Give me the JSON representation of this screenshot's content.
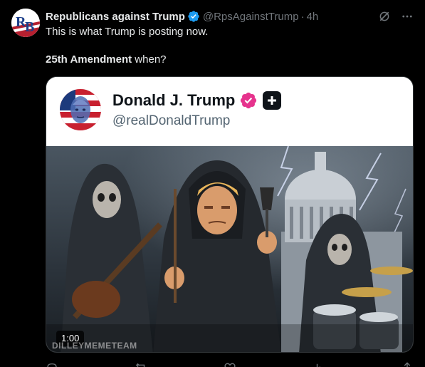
{
  "post": {
    "author_name": "Republicans against Trump",
    "author_avatar_text": "RB",
    "handle": "@RpsAgainstTrump",
    "separator": "·",
    "time": "4h",
    "text_line1": "This is what Trump is posting now.",
    "text_line2_bold": "25th Amendment",
    "text_line2_rest": " when?"
  },
  "embedded": {
    "name": "Donald J. Trump",
    "handle": "@realDonaldTrump",
    "video_time": "1:00",
    "watermark": "DILLEYMEMETEAM"
  },
  "colors": {
    "background": "#000000",
    "verified_blue": "#1d9bf0",
    "verified_pink": "#e6338d",
    "secondary_text": "#71767b"
  },
  "icons": {
    "verified": "blue-check-icon",
    "grok": "grok-icon",
    "more": "more-icon",
    "embedded_verified": "pink-check-icon",
    "embedded_badge": "plus-badge-icon"
  },
  "actions": [
    {
      "name": "reply-button",
      "icon": "reply-icon"
    },
    {
      "name": "repost-button",
      "icon": "repost-icon"
    },
    {
      "name": "like-button",
      "icon": "heart-icon"
    },
    {
      "name": "views-button",
      "icon": "views-icon"
    },
    {
      "name": "share-button",
      "icon": "share-icon"
    }
  ]
}
